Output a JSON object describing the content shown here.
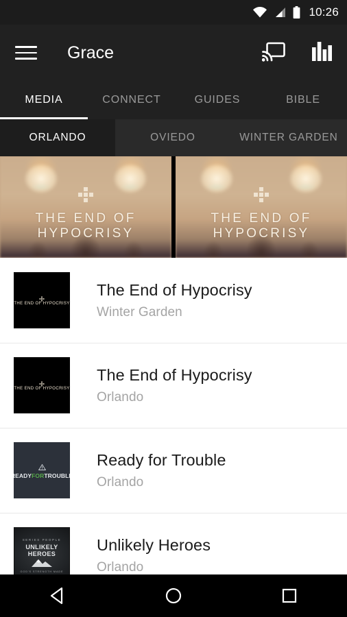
{
  "statusbar": {
    "time": "10:26",
    "icons": [
      "wifi-icon",
      "signal-icon",
      "battery-icon"
    ]
  },
  "appbar": {
    "menu_icon": "hamburger-menu-icon",
    "title": "Grace",
    "cast_icon": "cast-icon",
    "equalizer_icon": "equalizer-icon"
  },
  "tabs": [
    {
      "label": "MEDIA",
      "active": true
    },
    {
      "label": "CONNECT",
      "active": false
    },
    {
      "label": "GUIDES",
      "active": false
    },
    {
      "label": "BIBLE",
      "active": false
    }
  ],
  "subtabs": [
    {
      "label": "ORLANDO",
      "active": true
    },
    {
      "label": "OVIEDO",
      "active": false
    },
    {
      "label": "WINTER GARDEN",
      "active": false
    }
  ],
  "hero": [
    {
      "title": "THE END OF HYPOCRISY",
      "art": "church-interior-blurred"
    },
    {
      "title": "THE END OF HYPOCRISY",
      "art": "church-interior-blurred"
    }
  ],
  "list": [
    {
      "title": "The End of Hypocrisy",
      "subtitle": "Winter Garden",
      "thumb_kind": "church",
      "thumb_text": "THE END OF HYPOCRISY"
    },
    {
      "title": "The End of Hypocrisy",
      "subtitle": "Orlando",
      "thumb_kind": "church",
      "thumb_text": "THE END OF HYPOCRISY"
    },
    {
      "title": "Ready for Trouble",
      "subtitle": "Orlando",
      "thumb_kind": "trouble",
      "thumb_text_1": "READY",
      "thumb_text_2": "FOR",
      "thumb_text_3": "TROUBLE"
    },
    {
      "title": "Unlikely Heroes",
      "subtitle": "Orlando",
      "thumb_kind": "heroes",
      "thumb_arc": "SERIES PEOPLE",
      "thumb_main": "UNLIKELY HEROES",
      "thumb_sub": "GOD'S STRENGTH MADE"
    }
  ],
  "navbar": {
    "back": "back-icon",
    "home": "home-icon",
    "recents": "recents-icon"
  },
  "colors": {
    "appbar_bg": "#212121",
    "subtab_bg": "#2a2a2a",
    "subtab_active_bg": "#1d1d1d",
    "accent_text": "#ffffff",
    "inactive_text": "#9a9a9a",
    "list_title": "#1b1b1b",
    "list_sub": "#a4a4a4",
    "trouble_green": "#57a84b",
    "trouble_bg": "#2c313a"
  }
}
